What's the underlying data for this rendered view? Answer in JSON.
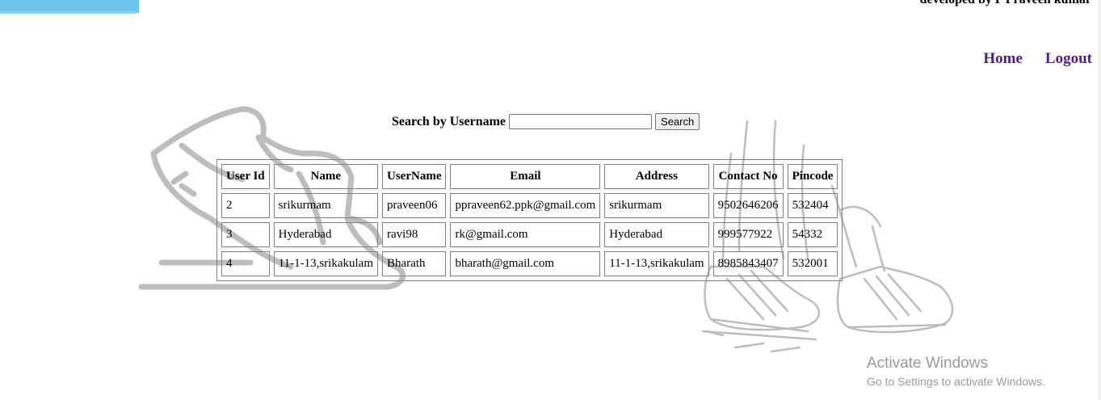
{
  "header": {
    "developer_credit": "developed by P Praveen kumar"
  },
  "nav": {
    "home_label": "Home",
    "logout_label": "Logout"
  },
  "search": {
    "label": "Search by Username",
    "value": "",
    "placeholder": "",
    "button_label": "Search"
  },
  "table": {
    "headers": [
      "User Id",
      "Name",
      "UserName",
      "Email",
      "Address",
      "Contact No",
      "Pincode"
    ],
    "rows": [
      [
        "2",
        "srikurmam",
        "praveen06",
        "ppraveen62.ppk@gmail.com",
        "srikurmam",
        "9502646206",
        "532404"
      ],
      [
        "3",
        "Hyderabad",
        "ravi98",
        "rk@gmail.com",
        "Hyderabad",
        "999577922",
        "54332"
      ],
      [
        "4",
        "11-1-13,srikakulam",
        "Bharath",
        "bharath@gmail.com",
        "11-1-13,srikakulam",
        "8985843407",
        "532001"
      ]
    ]
  },
  "watermark": {
    "title": "Activate Windows",
    "subtitle": "Go to Settings to activate Windows."
  },
  "colors": {
    "banner": "#6ec6ef",
    "link": "#551a8b",
    "art": "#bdbdbd"
  },
  "icons": [
    "shoe-illustration",
    "walking-legs-illustration"
  ]
}
